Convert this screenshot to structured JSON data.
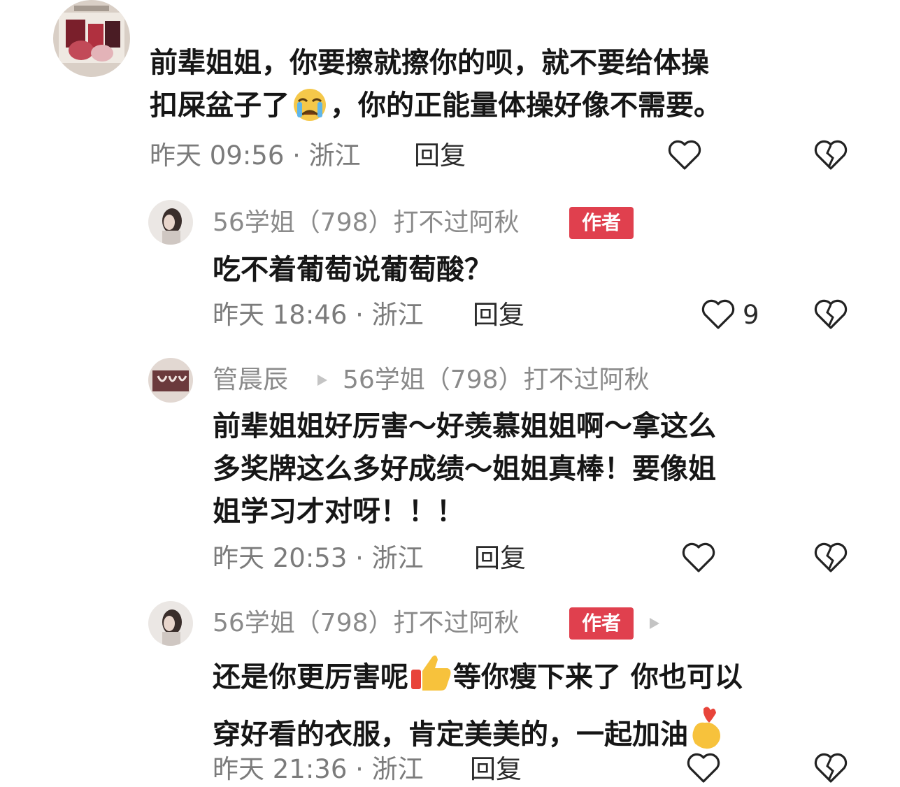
{
  "comments": [
    {
      "lines": [
        "前辈姐姐，你要擦就擦你的呗，就不要给体操",
        "扣屎盆子了",
        "，你的正能量体操好像不需要。"
      ],
      "meta": "昨天 09:56 · 浙江",
      "reply": "回复"
    },
    {
      "username": "56学姐（798）打不过阿秋",
      "badge": "作者",
      "lines": [
        "吃不着葡萄说葡萄酸？"
      ],
      "meta": "昨天 18:46 · 浙江",
      "reply": "回复",
      "likes": "9"
    },
    {
      "username": "管晨辰",
      "reply_to": "56学姐（798）打不过阿秋",
      "lines": [
        "前辈姐姐好厉害～好羡慕姐姐啊～拿这么",
        "多奖牌这么多好成绩～姐姐真棒！要像姐",
        "姐学习才对呀！！！"
      ],
      "meta": "昨天 20:53 · 浙江",
      "reply": "回复"
    },
    {
      "username": "56学姐（798）打不过阿秋",
      "badge": "作者",
      "lines": [
        "还是你更厉害呢",
        "等你瘦下来了 你也可以",
        "穿好看的衣服，肯定美美的，一起加油"
      ],
      "meta": "昨天 21:36 · 浙江",
      "reply": "回复"
    }
  ],
  "icons": {
    "like": "heart-outline-icon",
    "dislike": "broken-heart-icon",
    "reply_arrow": "play-triangle-icon",
    "crying": "crying-emoji",
    "thumbs_up": "thumbs-up-emoji",
    "finger_heart": "finger-heart-emoji"
  },
  "colors": {
    "badge": "#e0404e",
    "meta": "#7b7b7b",
    "text": "#161616"
  }
}
